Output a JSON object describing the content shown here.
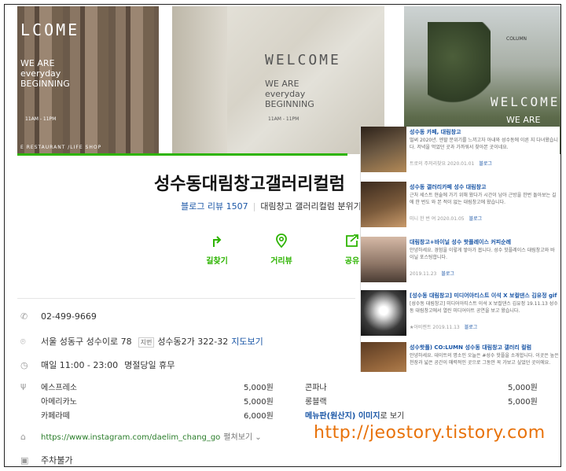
{
  "photos": {
    "left": {
      "welcome": "LCOME",
      "line1": "WE ARE",
      "line2": "everyday",
      "line3": "BEGINNING",
      "hours": "11AM - 11PM",
      "footer": "E  RESTAURANT /LIFE SHOP"
    },
    "center": {
      "welcome": "WELCOME",
      "line1": "WE ARE",
      "line2": "everyday",
      "line3": "BEGINNING",
      "hours": "11AM - 11PM"
    },
    "right": {
      "brand": "COLUMN",
      "welcome": "WELCOME",
      "line1": "WE ARE"
    }
  },
  "place": {
    "title": "성수동대림창고갤러리컬럼",
    "blog_review": "블로그 리뷰 1507",
    "tags": "대림창고 갤러리컬럼 분위기좋"
  },
  "actions": [
    {
      "label": "길찾기",
      "icon": "directions-icon"
    },
    {
      "label": "거리뷰",
      "icon": "street-view-icon"
    },
    {
      "label": "공유",
      "icon": "share-icon"
    }
  ],
  "info": {
    "phone": "02-499-9669",
    "address": "서울 성동구 성수이로 78",
    "jibun_tag": "지번",
    "jibun": "성수동2가 322-32",
    "map_link": "지도보기",
    "hours": "매일 11:00 - 23:00",
    "holiday": "명절당일 휴무",
    "website": "https://www.instagram.com/daelim_chang_go",
    "website_more": "펼쳐보기",
    "parking": "주차불가"
  },
  "menu": {
    "items": [
      {
        "name": "에스프레소",
        "price": "5,000원"
      },
      {
        "name": "아메리카노",
        "price": "5,000원"
      },
      {
        "name": "카페라떼",
        "price": "6,000원"
      },
      {
        "name": "콘파나",
        "price": "5,000원"
      },
      {
        "name": "롱블랙",
        "price": "5,000원"
      }
    ],
    "more_label": "메뉴판(원산지) 이미지",
    "more_suffix": "로 보기"
  },
  "reviews": [
    {
      "title": "성수동 카페, 대림창고",
      "body": "벌써 2020년. 엔할 분위기를 느끼고자 아내와 성수동에 이른 지 다녀왔습니다. 저녁을 먹었던 곳과 가까워서 찾아본 곳이네요.",
      "author": "트로의 주저리찾요",
      "date": "2020.01.01",
      "category": "블로그"
    },
    {
      "title": "성수동 갤러리카페 성수 대림창고",
      "body": "근처 세스트 현술에 가기 위해 왔다가 시간이 남아 근방을 한번 돌아보는 길에 한 번도 와 본 적이 없는 대림창고에 왔습니다.",
      "author": "미니 한 번 여",
      "date": "2020.01.05",
      "category": "블로그"
    },
    {
      "title": "대림창고+바이닐 성수 핫플레이스 커피순례",
      "body": "안녕하세요. 경험을 이렇게 쌓아가 봅니다. 성수 핫플레이스 대림창고와 바이닐 포스팅합니다.",
      "author": "",
      "date": "2019.11.23",
      "category": "블로그"
    },
    {
      "title": "[성수동 대림창고] 미디어아티스트 이석 X 보컬댄스 김유정 gif",
      "body": "[성수동 대림창고] 미디어아티스트 이석 X 보컬댄스 김유정 19.11.13 성수동 대림창고에서 열린 미디어아트 공연을 보고 왔습니다.",
      "author": "★아비렌트",
      "date": "2019.11.13",
      "category": "블로그"
    },
    {
      "title": "성수핫플) CO:LUMN 성수동 대림창고 갤러리 컬럼",
      "body": "안녕하세요. 데이트의 명소인 오늘은 #성수 핫플을 소개합니다. 이곳은 높은 천장과 넓은 공간이 매력적인 곳으로 그동안 꼭 가보고 싶었던 곳이에요.",
      "author": "",
      "date": "",
      "category": ""
    }
  ],
  "watermark": "http://jeostory.tistory.com",
  "colors": {
    "accent_green": "#2db400",
    "link_blue": "#1a56a6",
    "watermark_orange": "#e8720a"
  }
}
